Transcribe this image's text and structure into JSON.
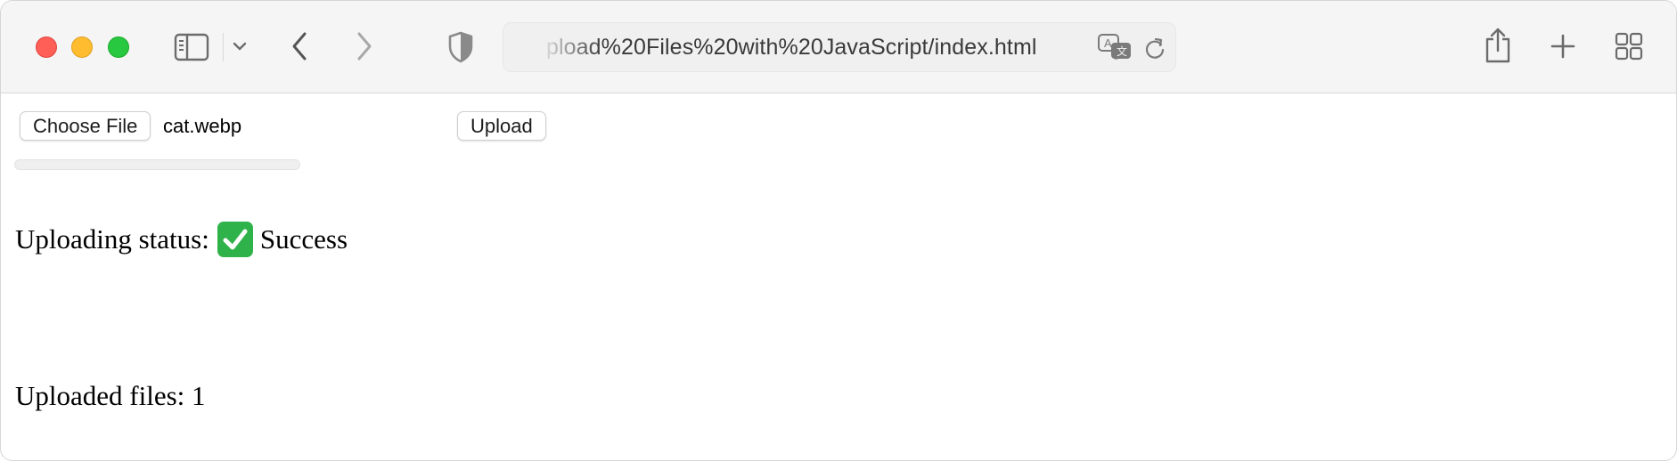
{
  "browser": {
    "address_url": "pload%20Files%20with%20JavaScript/index.html",
    "icons": {
      "sidebar": "sidebar-icon",
      "sidebar_menu": "chevron-down-icon",
      "back": "chevron-left-icon",
      "forward": "chevron-right-icon",
      "privacy": "shield-icon",
      "translate": "translate-icon",
      "reload": "reload-icon",
      "share": "share-icon",
      "new_tab": "plus-icon",
      "tab_overview": "grid-icon"
    },
    "traffic_lights": {
      "close_color": "#ff5f57",
      "minimize_color": "#febc2e",
      "maximize_color": "#28c840"
    }
  },
  "page": {
    "file_input": {
      "button_label": "Choose File",
      "file_name": "cat.webp"
    },
    "upload_button_label": "Upload",
    "progress_value": 0,
    "status": {
      "label": "Uploading status:",
      "icon": "check-mark-button-icon",
      "value": "Success"
    },
    "uploaded_files": "Uploaded files: 1"
  }
}
